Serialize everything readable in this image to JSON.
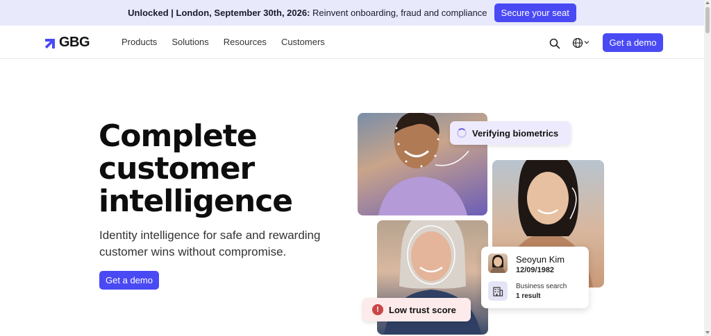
{
  "banner": {
    "bold_text": "Unlocked | London, September 30th, 2026:",
    "text": " Reinvent onboarding, fraud and compliance",
    "cta_label": "Secure your seat"
  },
  "header": {
    "logo_text": "GBG",
    "nav": [
      "Products",
      "Solutions",
      "Resources",
      "Customers"
    ],
    "demo_label": "Get a demo"
  },
  "hero": {
    "title_lines": [
      "Complete",
      "customer",
      "intelligence"
    ],
    "subtitle": "Identity intelligence for safe and rewarding customer wins without compromise.",
    "demo_label": "Get a demo"
  },
  "badges": {
    "verifying": "Verifying biometrics",
    "trust": "Low trust score"
  },
  "profile_card": {
    "name": "Seoyun Kim",
    "dob": "12/09/1982",
    "business_title": "Business search",
    "business_result": "1 result"
  },
  "colors": {
    "accent": "#4a4af4",
    "banner_bg": "#e8e9fb",
    "alert": "#c94747"
  }
}
